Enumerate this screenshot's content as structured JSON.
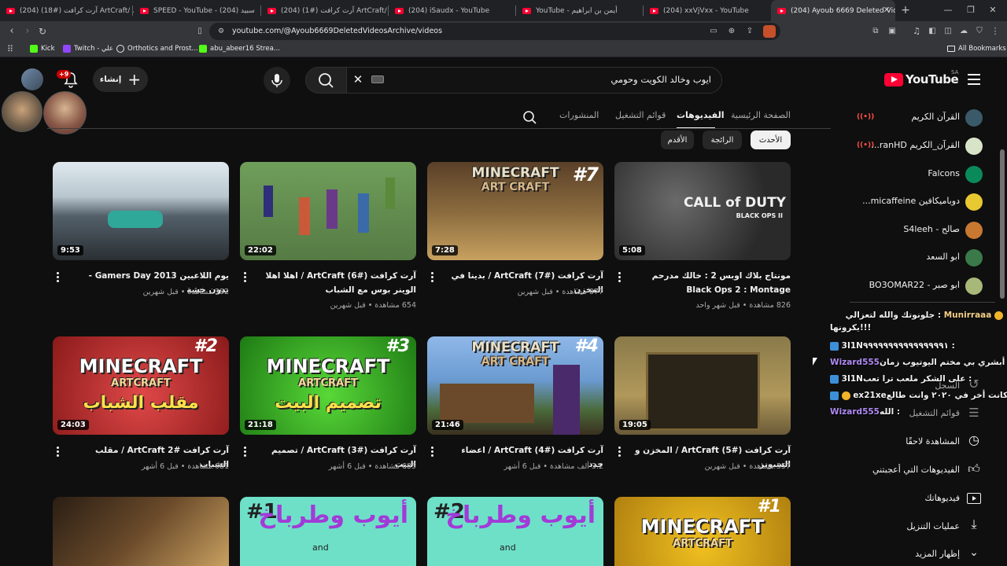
{
  "browser": {
    "tabs": [
      {
        "label": "(204) آرت كرافت (#18) ArtCraft/ الحلـ"
      },
      {
        "label": "SPEED - YouTube - سبيد (204)"
      },
      {
        "label": "(204) آرت كرافت (#1) ArtCraft/ جزيرة"
      },
      {
        "label": "(204) iSaudx - YouTube"
      },
      {
        "label": "YouTube - أيمن بن ابراهيم"
      },
      {
        "label": "(204) xxVjVxx - YouTube"
      },
      {
        "label": "(204) Ayoub 6669 Deleted Video"
      }
    ],
    "url": "youtube.com/@Ayoub6669DeletedVideosArchive/videos",
    "bookmarks": [
      "Kick",
      "Twitch - علي",
      "Orthotics and Prost...",
      "abu_abeer16 Strea..."
    ],
    "all_bookmarks": "All Bookmarks"
  },
  "header": {
    "logo_text": "YouTube",
    "region": "SA",
    "search_value": "ايوب وخالد الكويت وحومي",
    "create_label": "إنشاء",
    "notif_count": "+9"
  },
  "channel_tabs": [
    "الصفحة الرئيسية",
    "الفيديوهات",
    "قوائم التشغيل",
    "المنشورات"
  ],
  "chips": [
    "الأحدث",
    "الرائجة",
    "الأقدم"
  ],
  "videos": [
    {
      "duration": "9:53",
      "title": "يوم اللاعبين Gamers Day 2013 - بدون خشة",
      "meta": "382 مشاهدة • قبل شهرين"
    },
    {
      "duration": "22:02",
      "title": "آرت كرافت (#6) ArtCraft / اهلا اهلا الوينر بوس مع الشباب",
      "meta": "654 مشاهدة • قبل شهرين"
    },
    {
      "duration": "7:28",
      "title": "آرت كرافت (#7) ArtCraft / بدينا في المخزن",
      "meta": "877 مشاهدة • قبل شهرين"
    },
    {
      "duration": "5:08",
      "title": "مونتاج بلاك اوبس 2 : خالك مدرحم Black Ops 2 : Montage",
      "meta": "826 مشاهدة • قبل شهر واحد"
    },
    {
      "duration": "24:03",
      "title": "آرت كرافت #2 ArtCraft / مقلب الشباب",
      "meta": "681 مشاهدة • قبل 6 أشهر"
    },
    {
      "duration": "21:18",
      "title": "آرت كرافت (#3) ArtCraft / تصميم البيت",
      "meta": "685 مشاهدة • قبل 6 أشهر"
    },
    {
      "duration": "21:46",
      "title": "آرت كرافت (#4) ArtCraft / اعضاء جدد",
      "meta": "3.2 ألف مشاهدة • قبل 6 أشهر"
    },
    {
      "duration": "19:05",
      "title": "آرت كرافت (#5) ArtCraft / المخزن و السبونر",
      "meta": "357 مشاهدة • قبل شهرين"
    }
  ],
  "thumb_text": {
    "minecraft": "MINECRAFT",
    "art_craft": "ART CRAFT",
    "artcraft": "ARTCRAFT",
    "n7": "#7",
    "n2": "#2",
    "n3": "#3",
    "n4": "#4",
    "n1": "#1",
    "prank": "مقلب الشباب",
    "house": "تصميم البيت",
    "cod1": "CALL of DUTY",
    "cod2": "BLACK OPS II",
    "ayoub_cook": "أيوب وطرباخ",
    "and": "and"
  },
  "sidebar": {
    "subs": [
      {
        "name": "القرآن الكريم",
        "live": true,
        "color": "#3a5a6a"
      },
      {
        "name": "القرآن_الكريم ranHD...",
        "live": true,
        "color": "#d8e4c8"
      },
      {
        "name": "Falcons",
        "live": false,
        "color": "#0a8a5a"
      },
      {
        "name": "دوباميكافين micaffeine...",
        "live": false,
        "color": "#e8c830"
      },
      {
        "name": "صالح - S4leeh",
        "live": false,
        "color": "#c87830"
      },
      {
        "name": "ابو السعد",
        "live": false,
        "color": "#3a7a4a"
      },
      {
        "name": "ابو صبر - BO3OMAR22",
        "live": false,
        "color": "#a8b878"
      }
    ],
    "you": [
      {
        "label": "السجل",
        "icon": "history-icon"
      },
      {
        "label": "قوائم التشغيل",
        "icon": "playlist-icon"
      },
      {
        "label": "المشاهدة لاحقًا",
        "icon": "clock-icon"
      },
      {
        "label": "الفيديوهات التي أعجبتني",
        "icon": "like-icon"
      },
      {
        "label": "فيديوهاتك",
        "icon": "video-icon"
      },
      {
        "label": "عمليات التنزيل",
        "icon": "download-icon"
      },
      {
        "label": "إظهار المزيد",
        "icon": "chevron-down-icon"
      }
    ]
  },
  "chat": [
    {
      "user": "Munirraaa",
      "msg": "جلونوتك والله لتعزالي : ",
      "msg2": "يكرونها!!!",
      "color": "#f5d08a"
    },
    {
      "user": "3I1N",
      "msg": "٩٩٩٩٩٩٩٩٩٩٩٩٩٩٩٩١ : ",
      "color": "#f1f1f1"
    },
    {
      "user": "Wizard555",
      "msg": "أبشري بي مختم اليوتيوب زمان : ",
      "color": "#b08af5"
    },
    {
      "user": "3I1N",
      "msg": "على الشكر ملعب ترا تعب : ",
      "color": "#f1f1f1"
    },
    {
      "user": "ex21xe",
      "msg": "متى كانت أخر في ٢٠٢٠ وانت طالع : ",
      "color": "#f1f1f1"
    },
    {
      "user": "Wizard555",
      "msg": "الله : ",
      "color": "#b08af5"
    }
  ],
  "colors": {
    "yt_red": "#ff0033",
    "bg": "#0f0f0f",
    "chip": "#272727"
  }
}
